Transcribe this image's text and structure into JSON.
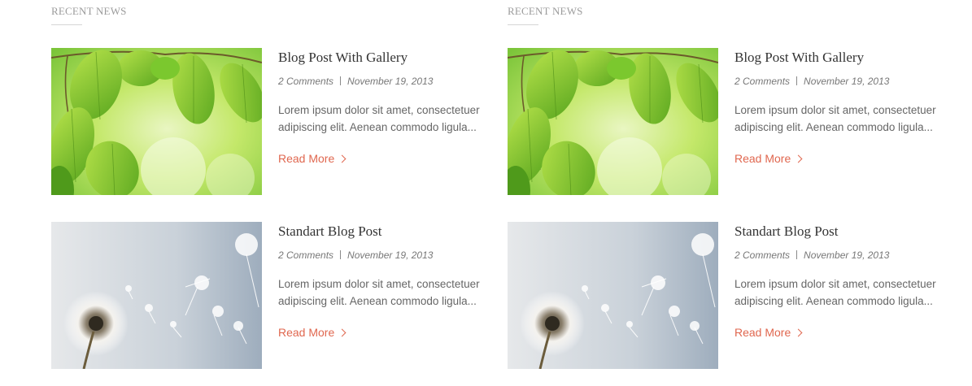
{
  "sections": [
    {
      "title": "RECENT NEWS",
      "posts": [
        {
          "title": "Blog Post With Gallery",
          "image_subject": "green-leaves",
          "comments": "2 Comments",
          "date": "November 19, 2013",
          "excerpt": "Lorem ipsum dolor sit amet, consectetuer adipiscing elit. Aenean commodo ligula...",
          "read_more": "Read More"
        },
        {
          "title": "Standart Blog Post",
          "image_subject": "dandelion",
          "comments": "2 Comments",
          "date": "November 19, 2013",
          "excerpt": "Lorem ipsum dolor sit amet, consectetuer adipiscing elit. Aenean commodo ligula...",
          "read_more": "Read More"
        }
      ]
    },
    {
      "title": "RECENT NEWS",
      "posts": [
        {
          "title": "Blog Post With Gallery",
          "image_subject": "green-leaves",
          "comments": "2 Comments",
          "date": "November 19, 2013",
          "excerpt": "Lorem ipsum dolor sit amet, consectetuer adipiscing elit. Aenean commodo ligula...",
          "read_more": "Read More"
        },
        {
          "title": "Standart Blog Post",
          "image_subject": "dandelion",
          "comments": "2 Comments",
          "date": "November 19, 2013",
          "excerpt": "Lorem ipsum dolor sit amet, consectetuer adipiscing elit. Aenean commodo ligula...",
          "read_more": "Read More"
        }
      ]
    }
  ],
  "colors": {
    "accent": "#e0674f",
    "heading": "#333333",
    "meta": "#777777",
    "muted_title": "#9b9b9b"
  }
}
